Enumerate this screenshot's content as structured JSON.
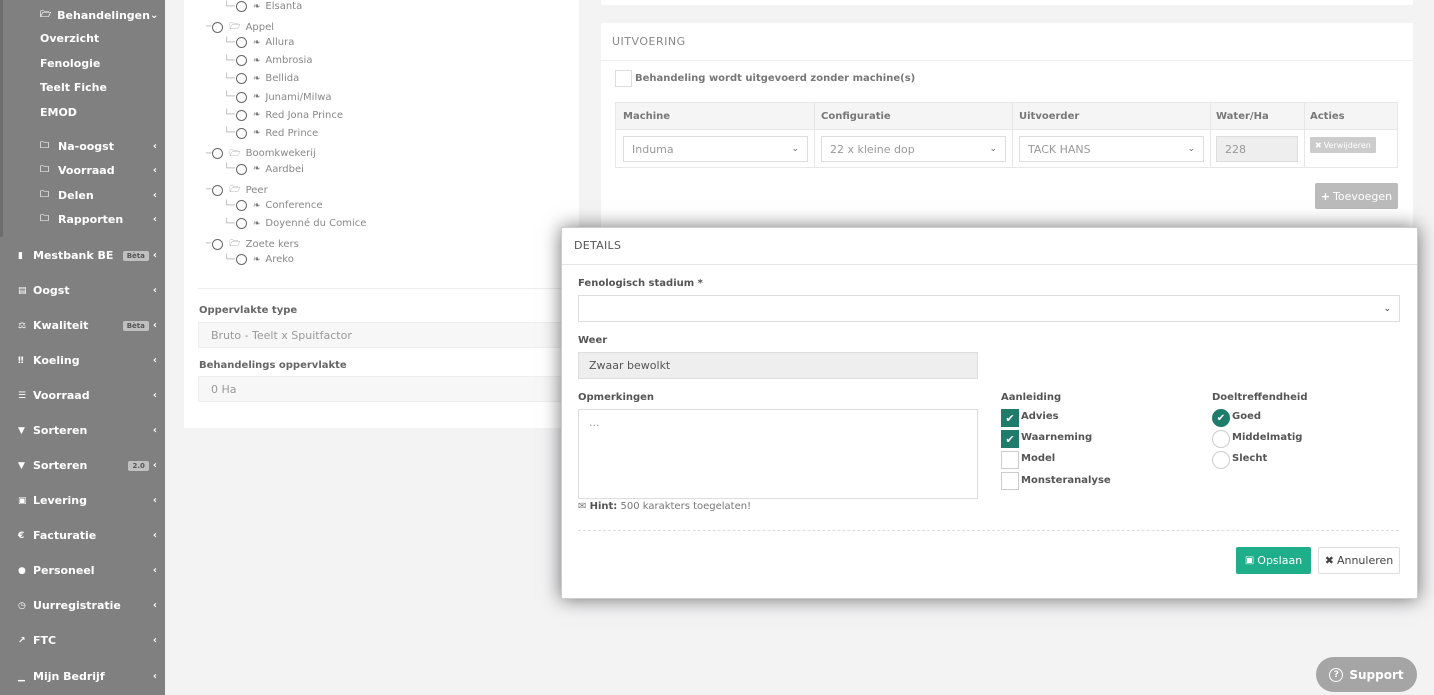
{
  "sidebar": {
    "group_open": "Behandelingen",
    "sub_items": [
      "Overzicht",
      "Fenologie",
      "Teelt Fiche",
      "EMOD"
    ],
    "sub_groups": [
      "Na-oogst",
      "Voorraad",
      "Delen",
      "Rapporten"
    ],
    "main_items": [
      {
        "label": "Mestbank BE",
        "badge": "Bèta"
      },
      {
        "label": "Oogst",
        "badge": ""
      },
      {
        "label": "Kwaliteit",
        "badge": "Bèta"
      },
      {
        "label": "Koeling",
        "badge": ""
      },
      {
        "label": "Voorraad",
        "badge": ""
      },
      {
        "label": "Sorteren",
        "badge": ""
      },
      {
        "label": "Sorteren",
        "badge": "2.0"
      },
      {
        "label": "Levering",
        "badge": ""
      },
      {
        "label": "Facturatie",
        "badge": ""
      },
      {
        "label": "Personeel",
        "badge": ""
      },
      {
        "label": "Uurregistratie",
        "badge": ""
      },
      {
        "label": "FTC",
        "badge": ""
      },
      {
        "label": "Mijn Bedrijf",
        "badge": ""
      }
    ]
  },
  "tree": [
    {
      "label": "Elsanta",
      "level": 2
    },
    {
      "label": "Appel",
      "level": 1
    },
    {
      "label": "Allura",
      "level": 2
    },
    {
      "label": "Ambrosia",
      "level": 2
    },
    {
      "label": "Bellida",
      "level": 2
    },
    {
      "label": "Junami/Milwa",
      "level": 2
    },
    {
      "label": "Red Jona Prince",
      "level": 2
    },
    {
      "label": "Red Prince",
      "level": 2
    },
    {
      "label": "Boomkwekerij",
      "level": 1
    },
    {
      "label": "Aardbei",
      "level": 2
    },
    {
      "label": "Peer",
      "level": 1
    },
    {
      "label": "Conference",
      "level": 2
    },
    {
      "label": "Doyenné du Comice",
      "level": 2
    },
    {
      "label": "Zoete kers",
      "level": 1
    },
    {
      "label": "Areko",
      "level": 2
    }
  ],
  "left_form": {
    "surface_type_label": "Oppervlakte type",
    "surface_type_value": "Bruto - Teelt x Spuitfactor",
    "treatment_area_label": "Behandelings oppervlakte",
    "treatment_area_value": "0 Ha"
  },
  "uitvoering": {
    "title": "UITVOERING",
    "no_machine_label": "Behandeling wordt uitgevoerd zonder machine(s)",
    "columns": [
      "Machine",
      "Configuratie",
      "Uitvoerder",
      "Water/Ha",
      "Acties"
    ],
    "row": {
      "machine": "Induma",
      "configuratie": "22 x kleine dop",
      "uitvoerder": "TACK HANS",
      "water": "228"
    },
    "delete_label": "Verwijderen",
    "add_label": "Toevoegen"
  },
  "modal": {
    "title": "DETAILS",
    "stage_label": "Fenologisch stadium *",
    "stage_value": "",
    "weather_label": "Weer",
    "weather_value": "Zwaar bewolkt",
    "remarks_label": "Opmerkingen",
    "remarks_placeholder": "...",
    "hint_bold": "Hint:",
    "hint_text": "500 karakters toegelaten!",
    "aanleiding_label": "Aanleiding",
    "aanleiding": [
      {
        "label": "Advies",
        "checked": true
      },
      {
        "label": "Waarneming",
        "checked": true
      },
      {
        "label": "Model",
        "checked": false
      },
      {
        "label": "Monsteranalyse",
        "checked": false
      }
    ],
    "doel_label": "Doeltreffendheid",
    "doel": [
      {
        "label": "Goed",
        "checked": true
      },
      {
        "label": "Middelmatig",
        "checked": false
      },
      {
        "label": "Slecht",
        "checked": false
      }
    ],
    "save_label": "Opslaan",
    "cancel_label": "Annuleren"
  },
  "support_label": "Support",
  "colors": {
    "sidebar": "#808080",
    "primary": "#1fae8a",
    "checked": "#1f7c6b"
  }
}
